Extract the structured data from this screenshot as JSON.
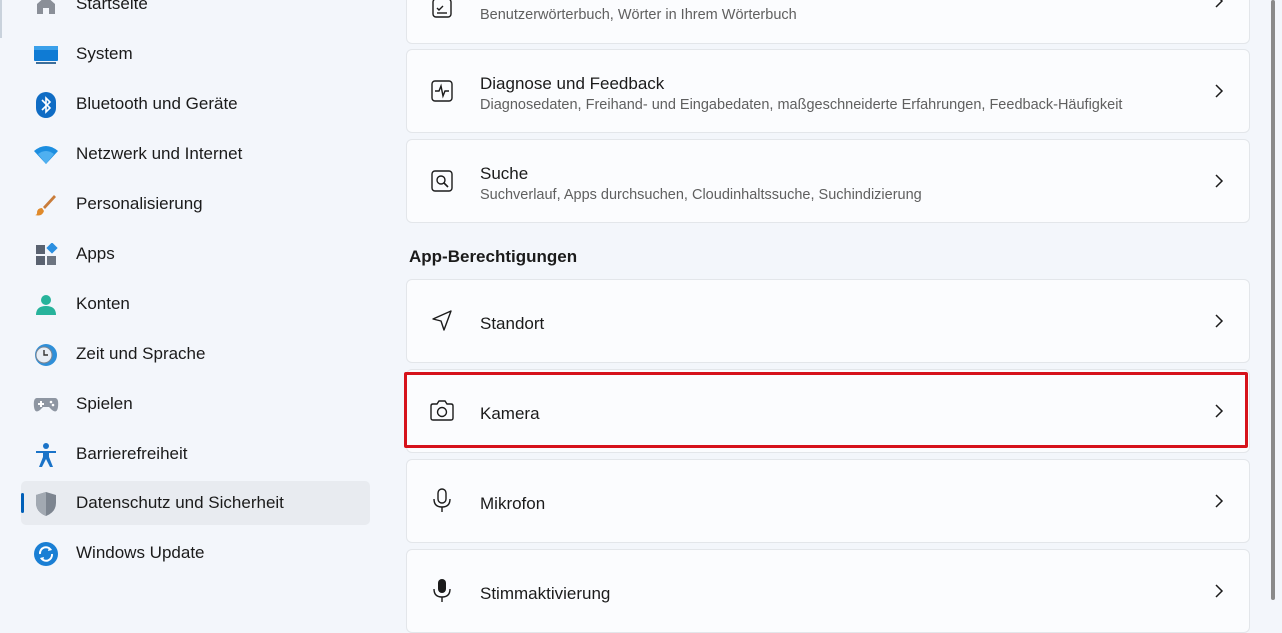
{
  "sidebar": {
    "items": [
      {
        "label": "Startseite",
        "icon": "home-icon"
      },
      {
        "label": "System",
        "icon": "monitor-icon"
      },
      {
        "label": "Bluetooth und Geräte",
        "icon": "bluetooth-icon"
      },
      {
        "label": "Netzwerk und Internet",
        "icon": "wifi-icon"
      },
      {
        "label": "Personalisierung",
        "icon": "brush-icon"
      },
      {
        "label": "Apps",
        "icon": "apps-icon"
      },
      {
        "label": "Konten",
        "icon": "person-icon"
      },
      {
        "label": "Zeit und Sprache",
        "icon": "clock-globe-icon"
      },
      {
        "label": "Spielen",
        "icon": "gamepad-icon"
      },
      {
        "label": "Barrierefreiheit",
        "icon": "accessibility-icon"
      },
      {
        "label": "Datenschutz und Sicherheit",
        "icon": "shield-icon",
        "selected": true
      },
      {
        "label": "Windows Update",
        "icon": "update-icon"
      }
    ]
  },
  "main": {
    "cards_top": [
      {
        "title": "",
        "subtitle": "Benutzerwörterbuch, Wörter in Ihrem Wörterbuch",
        "icon": "dictionary-icon"
      },
      {
        "title": "Diagnose und Feedback",
        "subtitle": "Diagnosedaten, Freihand- und Eingabedaten, maßgeschneiderte Erfahrungen, Feedback-Häufigkeit",
        "icon": "diagnostics-icon"
      },
      {
        "title": "Suche",
        "subtitle": "Suchverlauf, Apps durchsuchen, Cloudinhaltssuche, Suchindizierung",
        "icon": "search-icon"
      }
    ],
    "section_heading": "App-Berechtigungen",
    "permissions": [
      {
        "title": "Standort",
        "icon": "location-icon"
      },
      {
        "title": "Kamera",
        "icon": "camera-icon",
        "highlighted": true
      },
      {
        "title": "Mikrofon",
        "icon": "microphone-icon"
      },
      {
        "title": "Stimmaktivierung",
        "icon": "voice-activation-icon"
      }
    ]
  },
  "colors": {
    "accent": "#005fb8",
    "highlight_border": "#d6121b",
    "background": "#f3f6fb",
    "card": "#fbfcfe"
  }
}
